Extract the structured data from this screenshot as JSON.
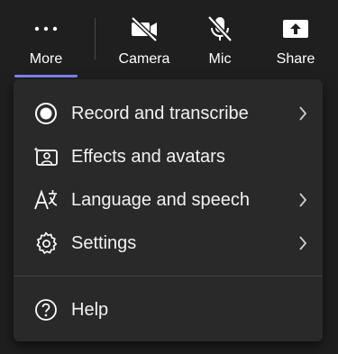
{
  "toolbar": {
    "more": {
      "label": "More",
      "icon": "more-dots-icon",
      "selected": true
    },
    "camera": {
      "label": "Camera",
      "icon": "video-off-icon",
      "state": "off"
    },
    "mic": {
      "label": "Mic",
      "icon": "mic-off-icon",
      "state": "off"
    },
    "share": {
      "label": "Share",
      "icon": "share-screen-icon"
    },
    "accent_color": "#7f85f5"
  },
  "menu": {
    "items": [
      {
        "label": "Record and transcribe",
        "icon": "record-icon",
        "has_submenu": true
      },
      {
        "label": "Effects and avatars",
        "icon": "effects-avatar-icon",
        "has_submenu": false
      },
      {
        "label": "Language and speech",
        "icon": "language-icon",
        "has_submenu": true
      },
      {
        "label": "Settings",
        "icon": "gear-icon",
        "has_submenu": true
      }
    ],
    "footer_items": [
      {
        "label": "Help",
        "icon": "help-icon",
        "has_submenu": false
      }
    ]
  }
}
